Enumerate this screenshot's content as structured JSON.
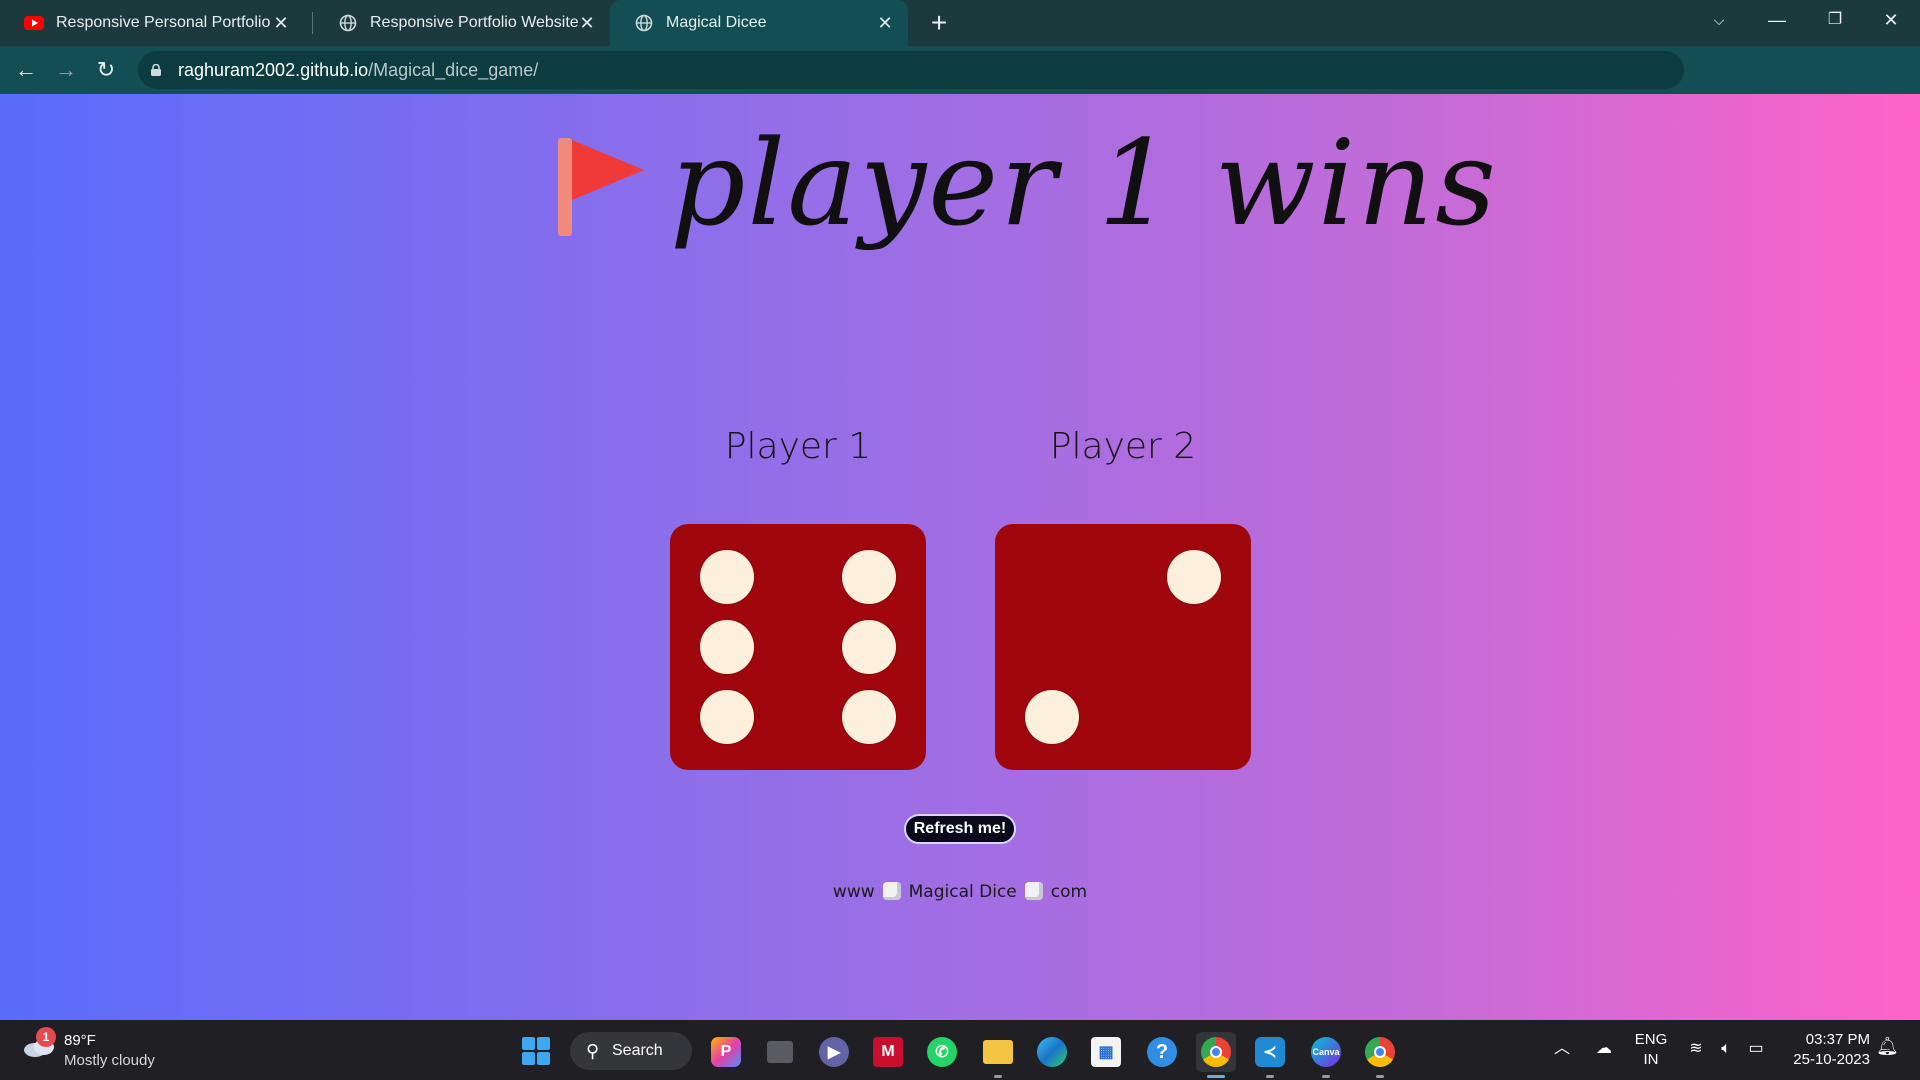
{
  "browser": {
    "tabs": [
      {
        "title": "Responsive Personal Portfolio W",
        "favicon": "youtube-icon",
        "active": false
      },
      {
        "title": "Responsive Portfolio Website",
        "favicon": "globe-icon",
        "active": false
      },
      {
        "title": "Magical Dicee",
        "favicon": "globe-icon",
        "active": true
      }
    ],
    "url_host": "raghuram2002.github.io",
    "url_path": "/Magical_dice_game/",
    "colors": {
      "tabstrip": "#1c3a3d",
      "toolbar": "#124e53"
    }
  },
  "page": {
    "headline": "player 1 wins",
    "flag_icon": "triangular-flag-icon",
    "players": [
      {
        "name": "Player 1",
        "die_value": 6
      },
      {
        "name": "Player 2",
        "die_value": 2
      }
    ],
    "refresh_label": "Refresh me!",
    "footer_left": "www",
    "footer_middle": "Magical Dice",
    "footer_right": "com",
    "colors": {
      "die": "#a0070d",
      "pip": "#fcf0dc",
      "gradient_start": "#5a6cfb",
      "gradient_end": "#ff63c8"
    }
  },
  "taskbar": {
    "weather_badge": "1",
    "temperature": "89°F",
    "weather_desc": "Mostly cloudy",
    "search_label": "Search",
    "language": "ENG",
    "region": "IN",
    "time": "03:37 PM",
    "date": "25-10-2023"
  }
}
